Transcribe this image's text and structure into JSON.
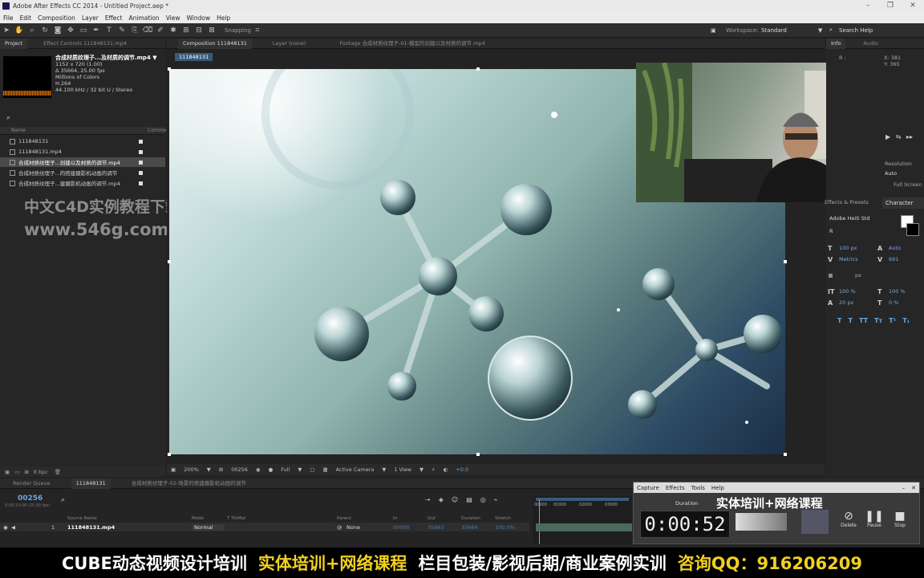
{
  "window": {
    "title": "Adobe After Effects CC 2014 - Untitled Project.aep *"
  },
  "menu": [
    "File",
    "Edit",
    "Composition",
    "Layer",
    "Effect",
    "Animation",
    "View",
    "Window",
    "Help"
  ],
  "toolbar": {
    "snapping": "Snapping",
    "workspace_label": "Workspace:",
    "workspace_value": "Standard",
    "search": "Search Help"
  },
  "project_panel": {
    "tabs": [
      "Project",
      "Effect Controls 111848131.mp4"
    ],
    "selected_file": "合成材质纹理子...及材质的调节.mp4 ▼",
    "meta": [
      "1152 x 720 (1.00)",
      "Δ 35664, 25.00 fps",
      "Millions of Colors",
      "H.264",
      "44.100 kHz / 32 bit U / Stereo"
    ],
    "col_name": "Name",
    "col_comment": "Comme",
    "files": [
      "111848131",
      "111848131.mp4",
      "合成材质纹理子...创建以及材质的调节.mp4",
      "合成材质纹理子...的搭建摄影机动画的调节",
      "合成材质纹理子...建摄影机动画的调节.mp4"
    ],
    "bpc": "8 bpc"
  },
  "comp_panel": {
    "tabs": [
      "Composition 111848131",
      "Layer (none)",
      "Footage 合成材质纹理子-01-模型的创建以及材质的调节.mp4"
    ],
    "comp_label": "111848131",
    "footer": {
      "zoom": "200%",
      "timecode": "00256",
      "resolution": "Full",
      "camera": "Active Camera",
      "view": "1 View",
      "exposure": "+0.0"
    }
  },
  "watermark": {
    "line1": "中文C4D实例教程下载",
    "line2": "www.546g.com"
  },
  "info_panel": {
    "tabs": [
      "Info",
      "Audio"
    ],
    "r": "R :",
    "x": "X: 381",
    "y": "Y: 365"
  },
  "preview_panel": {
    "resolution_label": "Resolution",
    "resolution": "Auto",
    "full_screen": "Full Screen"
  },
  "effects_panel": {
    "title": "Effects & Presets"
  },
  "character_panel": {
    "title": "Character",
    "font": "Adobe Heiti Std",
    "style": "R",
    "size": "100 px",
    "leading": "Auto",
    "kerning": "Metrics",
    "tracking": "691",
    "stroke": "px",
    "v_scale": "100 %",
    "h_scale": "100 %",
    "baseline": "20 px",
    "tsume": "0 %",
    "styles": [
      "T",
      "T",
      "TT",
      "Tт",
      "T¹",
      "T₁"
    ]
  },
  "timeline": {
    "tabs": [
      "Render Queue",
      "111848131",
      "合成材质纹理子-02-场景的搭建摄影机动画的调节"
    ],
    "timecode": "00256",
    "timecode_sub": "0:00:10:06 (25.00 fps)",
    "columns": [
      "Source Name",
      "Mode",
      "T TrkMat",
      "Parent",
      "In",
      "Out",
      "Duration",
      "Stretch"
    ],
    "layer": {
      "num": "1",
      "name": "111848131.mp4",
      "mode": "Normal",
      "parent": "None",
      "in": "00000",
      "out": "35663",
      "duration": "35664",
      "stretch": "100.0%"
    },
    "ruler": [
      "00000",
      "01000",
      "02000",
      "03000"
    ]
  },
  "recorder": {
    "menu": [
      "Capture",
      "Effects",
      "Tools",
      "Help"
    ],
    "duration_label": "Duration",
    "time": "0:00:52",
    "buttons": [
      "Delete",
      "Pause",
      "Stop"
    ],
    "overlay": "实体培训+网络课程"
  },
  "banner": {
    "part1": "CUBE动态视频设计培训",
    "part2": "实体培训+网络课程",
    "part3": "栏目包装/影视后期/商业案例实训",
    "part4": "咨询QQ：916206209"
  }
}
